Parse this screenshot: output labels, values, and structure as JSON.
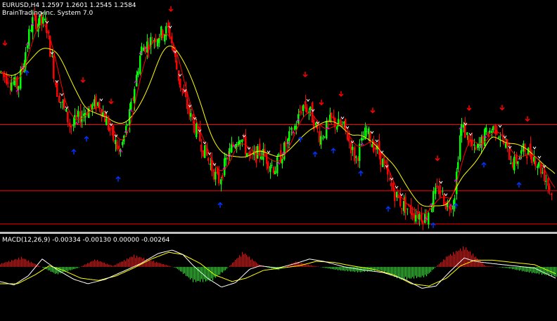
{
  "header": {
    "symbol_line": "EURUSD,H4  1.2597 1.2601 1.2545 1.2584",
    "indicator_name": "BrainTrading Inc. System 7.0"
  },
  "macd_label": "MACD(12,26,9) -0.00334 -0.00130 0.00000 -0.00264",
  "colors": {
    "background": "#000000",
    "bull": "#00ff00",
    "bear": "#ff0000",
    "ma_slow": "#ffff00",
    "ma_fast": "#ff0000",
    "signal_white": "#ffffff",
    "signal_magenta": "#ff00ff",
    "arrow_up": "#0033ff",
    "arrow_down": "#ff0000",
    "hline": "#ff0000",
    "macd_line": "#ffffff",
    "macd_signal": "#ffff00",
    "separator": "#c0c0c0"
  },
  "chart_data": [
    {
      "type": "candlestick",
      "symbol": "EURUSD",
      "timeframe": "H4",
      "ohlc": {
        "open": 1.2597,
        "high": 1.2601,
        "low": 1.2545,
        "close": 1.2584
      },
      "trend_path": [
        [
          0,
          0.7
        ],
        [
          25,
          0.63
        ],
        [
          45,
          0.93
        ],
        [
          65,
          0.92
        ],
        [
          80,
          0.62
        ],
        [
          100,
          0.45
        ],
        [
          120,
          0.52
        ],
        [
          140,
          0.56
        ],
        [
          160,
          0.4
        ],
        [
          170,
          0.33
        ],
        [
          185,
          0.52
        ],
        [
          200,
          0.8
        ],
        [
          210,
          0.83
        ],
        [
          225,
          0.87
        ],
        [
          240,
          0.89
        ],
        [
          255,
          0.65
        ],
        [
          270,
          0.5
        ],
        [
          290,
          0.34
        ],
        [
          310,
          0.2
        ],
        [
          325,
          0.33
        ],
        [
          340,
          0.42
        ],
        [
          355,
          0.3
        ],
        [
          370,
          0.34
        ],
        [
          390,
          0.26
        ],
        [
          405,
          0.36
        ],
        [
          420,
          0.46
        ],
        [
          430,
          0.55
        ],
        [
          440,
          0.52
        ],
        [
          455,
          0.4
        ],
        [
          470,
          0.48
        ],
        [
          490,
          0.44
        ],
        [
          505,
          0.3
        ],
        [
          520,
          0.43
        ],
        [
          540,
          0.32
        ],
        [
          555,
          0.18
        ],
        [
          570,
          0.1
        ],
        [
          590,
          0.06
        ],
        [
          605,
          0.04
        ],
        [
          615,
          0.13
        ],
        [
          625,
          0.17
        ],
        [
          635,
          0.09
        ],
        [
          645,
          0.12
        ],
        [
          655,
          0.46
        ],
        [
          665,
          0.4
        ],
        [
          675,
          0.33
        ],
        [
          690,
          0.42
        ],
        [
          705,
          0.45
        ],
        [
          718,
          0.36
        ],
        [
          730,
          0.28
        ],
        [
          745,
          0.35
        ],
        [
          760,
          0.31
        ],
        [
          775,
          0.22
        ],
        [
          785,
          0.14
        ]
      ],
      "horizontal_levels": [
        0.46,
        0.16,
        0.01
      ],
      "up_arrows_at": [
        38,
        105,
        123,
        168,
        313,
        427,
        448,
        474,
        513,
        552,
        616,
        648,
        688,
        738
      ],
      "down_arrows_at": [
        7,
        118,
        158,
        243,
        434,
        457,
        485,
        530,
        622,
        667,
        714,
        750
      ]
    },
    {
      "type": "histogram+line",
      "name": "MACD(12,26,9)",
      "values": [
        -0.00334,
        -0.0013,
        0.0,
        -0.00264
      ],
      "histogram_envelope": [
        [
          0,
          0.15
        ],
        [
          30,
          0.45
        ],
        [
          55,
          0.05
        ],
        [
          80,
          -0.35
        ],
        [
          110,
          -0.05
        ],
        [
          135,
          0.35
        ],
        [
          160,
          0.05
        ],
        [
          190,
          0.55
        ],
        [
          220,
          0.25
        ],
        [
          250,
          -0.05
        ],
        [
          275,
          -0.7
        ],
        [
          300,
          -0.65
        ],
        [
          320,
          -0.15
        ],
        [
          345,
          0.7
        ],
        [
          370,
          0.05
        ],
        [
          395,
          -0.15
        ],
        [
          420,
          0.25
        ],
        [
          445,
          0.05
        ],
        [
          480,
          -0.15
        ],
        [
          510,
          -0.25
        ],
        [
          540,
          -0.15
        ],
        [
          570,
          -0.6
        ],
        [
          605,
          -0.45
        ],
        [
          635,
          0.5
        ],
        [
          660,
          0.95
        ],
        [
          690,
          0.05
        ],
        [
          720,
          -0.05
        ],
        [
          750,
          -0.25
        ],
        [
          790,
          -0.45
        ]
      ],
      "main_line": [
        [
          0,
          -0.65
        ],
        [
          20,
          -0.8
        ],
        [
          40,
          -0.4
        ],
        [
          60,
          0.35
        ],
        [
          80,
          -0.1
        ],
        [
          105,
          -0.55
        ],
        [
          125,
          -0.75
        ],
        [
          150,
          -0.55
        ],
        [
          175,
          -0.2
        ],
        [
          200,
          0.15
        ],
        [
          225,
          0.6
        ],
        [
          245,
          0.75
        ],
        [
          260,
          0.55
        ],
        [
          275,
          0.05
        ],
        [
          295,
          -0.5
        ],
        [
          315,
          -0.9
        ],
        [
          335,
          -0.7
        ],
        [
          355,
          -0.1
        ],
        [
          370,
          0.05
        ],
        [
          395,
          -0.05
        ],
        [
          420,
          0.15
        ],
        [
          440,
          0.35
        ],
        [
          460,
          0.25
        ],
        [
          490,
          0.0
        ],
        [
          520,
          -0.15
        ],
        [
          545,
          -0.25
        ],
        [
          575,
          -0.55
        ],
        [
          600,
          -0.95
        ],
        [
          620,
          -0.85
        ],
        [
          640,
          -0.2
        ],
        [
          660,
          0.4
        ],
        [
          675,
          0.25
        ],
        [
          700,
          0.15
        ],
        [
          730,
          0.05
        ],
        [
          760,
          -0.05
        ],
        [
          790,
          -0.5
        ]
      ],
      "signal_line": [
        [
          0,
          -0.75
        ],
        [
          25,
          -0.75
        ],
        [
          50,
          -0.35
        ],
        [
          70,
          0.05
        ],
        [
          90,
          -0.15
        ],
        [
          115,
          -0.5
        ],
        [
          140,
          -0.6
        ],
        [
          165,
          -0.4
        ],
        [
          190,
          -0.05
        ],
        [
          215,
          0.35
        ],
        [
          240,
          0.65
        ],
        [
          260,
          0.55
        ],
        [
          285,
          0.15
        ],
        [
          305,
          -0.35
        ],
        [
          330,
          -0.65
        ],
        [
          350,
          -0.5
        ],
        [
          375,
          -0.15
        ],
        [
          400,
          -0.05
        ],
        [
          425,
          0.05
        ],
        [
          450,
          0.25
        ],
        [
          475,
          0.2
        ],
        [
          500,
          0.05
        ],
        [
          530,
          -0.1
        ],
        [
          560,
          -0.35
        ],
        [
          585,
          -0.75
        ],
        [
          610,
          -0.85
        ],
        [
          635,
          -0.5
        ],
        [
          655,
          0.05
        ],
        [
          675,
          0.3
        ],
        [
          700,
          0.3
        ],
        [
          730,
          0.2
        ],
        [
          760,
          0.1
        ],
        [
          790,
          -0.3
        ]
      ]
    }
  ]
}
